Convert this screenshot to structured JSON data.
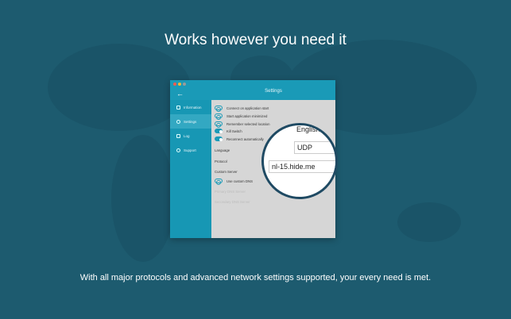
{
  "headline": "Works however you need it",
  "caption": "With all major protocols and advanced network settings supported, your every need is met.",
  "window": {
    "title": "Settings",
    "back_icon": "←"
  },
  "sidebar": {
    "items": [
      {
        "label": "Information",
        "icon": "info-icon"
      },
      {
        "label": "Settings",
        "icon": "gear-icon",
        "active": true
      },
      {
        "label": "Log",
        "icon": "log-icon"
      },
      {
        "label": "Support",
        "icon": "globe-icon"
      }
    ]
  },
  "settings": {
    "toggles": [
      {
        "label": "Connect on application start",
        "on": false
      },
      {
        "label": "Start application minimized",
        "on": false
      },
      {
        "label": "Remember selected location",
        "on": false
      },
      {
        "label": "Kill Switch",
        "on": true
      },
      {
        "label": "Reconnect automatically",
        "on": true
      }
    ],
    "language_label": "Language",
    "protocol_label": "Protocol",
    "custom_server_label": "Custom Server",
    "dns_toggle": {
      "label": "Use custom DNS",
      "on": false
    },
    "primary_dns_label": "Primary DNS Server",
    "secondary_dns_label": "Secondary DNS Server"
  },
  "magnifier": {
    "language_value": "English",
    "protocol_value": "UDP",
    "server_value": "nl-15.hide.me"
  },
  "colors": {
    "background": "#1d5b6f",
    "accent": "#1a9ab7",
    "ring": "#1f4a63"
  }
}
